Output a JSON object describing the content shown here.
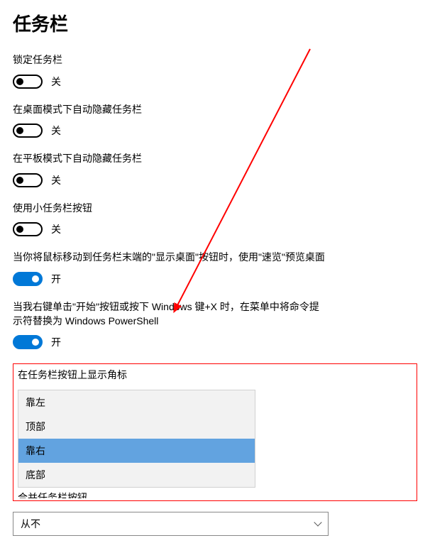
{
  "page": {
    "title": "任务栏"
  },
  "settings": {
    "lock_taskbar": {
      "label": "锁定任务栏",
      "state": "关",
      "on": false
    },
    "autohide_desktop": {
      "label": "在桌面模式下自动隐藏任务栏",
      "state": "关",
      "on": false
    },
    "autohide_tablet": {
      "label": "在平板模式下自动隐藏任务栏",
      "state": "关",
      "on": false
    },
    "small_buttons": {
      "label": "使用小任务栏按钮",
      "state": "关",
      "on": false
    },
    "peek_preview": {
      "label": "当你将鼠标移动到任务栏末端的\"显示桌面\"按钮时，使用\"速览\"预览桌面",
      "state": "开",
      "on": true
    },
    "powershell": {
      "label": "当我右键单击\"开始\"按钮或按下 Windows 键+X 时，在菜单中将命令提示符替换为 Windows PowerShell",
      "state": "开",
      "on": true
    },
    "badges": {
      "label": "在任务栏按钮上显示角标"
    },
    "position_dropdown": {
      "options": [
        {
          "label": "靠左"
        },
        {
          "label": "顶部"
        },
        {
          "label": "靠右",
          "selected": true
        },
        {
          "label": "底部"
        }
      ]
    },
    "truncated": {
      "label": "合并任务栏按钮"
    },
    "combine_select": {
      "value": "从不"
    }
  },
  "annotation": {
    "arrow_color": "#ff0000",
    "highlight_color": "#ff0000"
  }
}
